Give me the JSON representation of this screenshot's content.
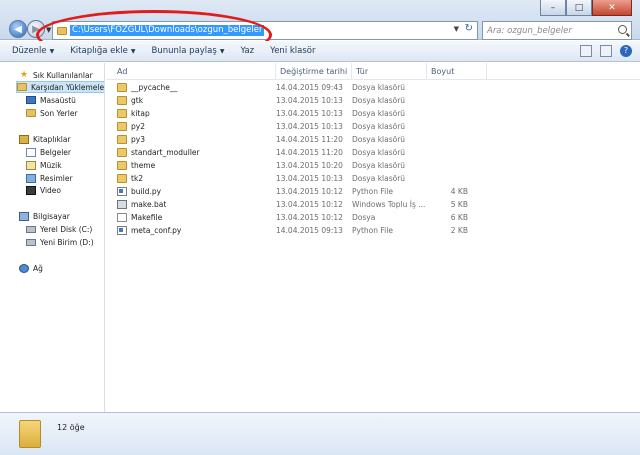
{
  "window": {
    "minimize": "–",
    "maximize": "□",
    "close": "✕"
  },
  "nav": {
    "back": "◀",
    "forward": "▶",
    "dropdown": "▼"
  },
  "address": {
    "path": "C:\\Users\\FOZGUL\\Downloads\\ozgun_belgeler",
    "dropdown": "▼",
    "refresh": "↻"
  },
  "search": {
    "placeholder": "Ara: ozgun_belgeler"
  },
  "toolbar": {
    "items": [
      {
        "label": "Düzenle",
        "has_caret": true
      },
      {
        "label": "Kitaplığa ekle",
        "has_caret": true
      },
      {
        "label": "Bununla paylaş",
        "has_caret": true
      },
      {
        "label": "Yaz",
        "has_caret": false
      },
      {
        "label": "Yeni klasör",
        "has_caret": false
      }
    ],
    "caret": "▼",
    "help": "?"
  },
  "sidebar": {
    "items": [
      {
        "label": "Sık Kullanılanlar",
        "icon": "star-icon"
      },
      {
        "label": "Karşıdan Yüklemeler",
        "icon": "downloads-folder-icon"
      },
      {
        "label": "Masaüstü",
        "icon": "desktop-icon"
      },
      {
        "label": "Son Yerler",
        "icon": "recent-places-icon"
      },
      {
        "label": "Kitaplıklar",
        "icon": "libraries-icon"
      },
      {
        "label": "Belgeler",
        "icon": "documents-icon"
      },
      {
        "label": "Müzik",
        "icon": "music-icon"
      },
      {
        "label": "Resimler",
        "icon": "pictures-icon"
      },
      {
        "label": "Video",
        "icon": "video-icon"
      },
      {
        "label": "Bilgisayar",
        "icon": "computer-icon"
      },
      {
        "label": "Yerel Disk (C:)",
        "icon": "drive-icon"
      },
      {
        "label": "Yeni Birim (D:)",
        "icon": "drive-icon"
      },
      {
        "label": "Ağ",
        "icon": "network-icon"
      }
    ]
  },
  "columns": {
    "name": "Ad",
    "date": "Değiştirme tarihi",
    "type": "Tür",
    "size": "Boyut"
  },
  "files": [
    {
      "name": "__pycache__",
      "date": "14.04.2015 09:43",
      "type": "Dosya klasörü",
      "size": "",
      "icon": "folder-icon"
    },
    {
      "name": "gtk",
      "date": "13.04.2015 10:13",
      "type": "Dosya klasörü",
      "size": "",
      "icon": "folder-icon"
    },
    {
      "name": "kitap",
      "date": "13.04.2015 10:13",
      "type": "Dosya klasörü",
      "size": "",
      "icon": "folder-icon"
    },
    {
      "name": "py2",
      "date": "13.04.2015 10:13",
      "type": "Dosya klasörü",
      "size": "",
      "icon": "folder-icon"
    },
    {
      "name": "py3",
      "date": "14.04.2015 11:20",
      "type": "Dosya klasörü",
      "size": "",
      "icon": "folder-icon"
    },
    {
      "name": "standart_moduller",
      "date": "14.04.2015 11:20",
      "type": "Dosya klasörü",
      "size": "",
      "icon": "folder-icon"
    },
    {
      "name": "theme",
      "date": "13.04.2015 10:20",
      "type": "Dosya klasörü",
      "size": "",
      "icon": "folder-icon"
    },
    {
      "name": "tk2",
      "date": "13.04.2015 10:13",
      "type": "Dosya klasörü",
      "size": "",
      "icon": "folder-icon"
    },
    {
      "name": "build.py",
      "date": "13.04.2015 10:12",
      "type": "Python File",
      "size": "4 KB",
      "icon": "python-file-icon"
    },
    {
      "name": "make.bat",
      "date": "13.04.2015 10:12",
      "type": "Windows Toplu İş ...",
      "size": "5 KB",
      "icon": "batch-file-icon"
    },
    {
      "name": "Makefile",
      "date": "13.04.2015 10:12",
      "type": "Dosya",
      "size": "6 KB",
      "icon": "file-icon"
    },
    {
      "name": "meta_conf.py",
      "date": "14.04.2015 09:13",
      "type": "Python File",
      "size": "2 KB",
      "icon": "python-file-icon"
    }
  ],
  "details": {
    "count": "12 öğe"
  },
  "colors": {
    "annotation": "#e21b1b",
    "selection": "#3399ff"
  }
}
